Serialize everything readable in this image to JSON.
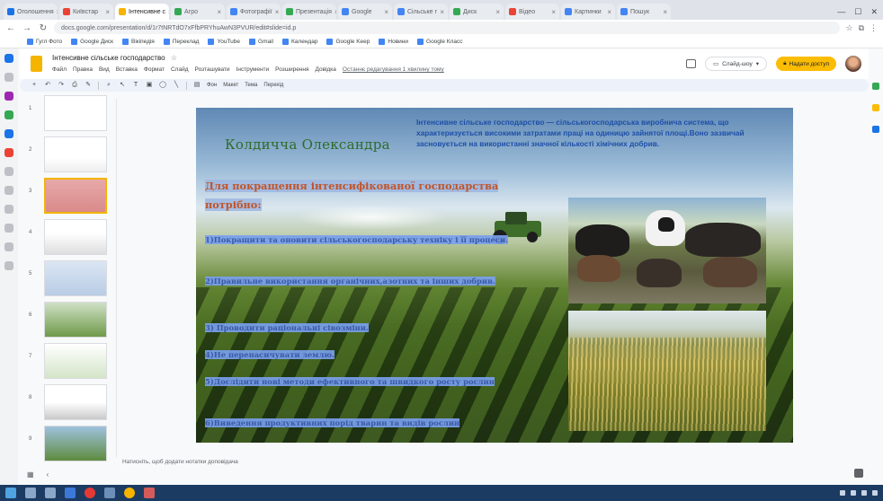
{
  "browser": {
    "tabs": [
      {
        "label": "Оголошення",
        "color": "#1a73e8"
      },
      {
        "label": "Київстар",
        "color": "#ea4335"
      },
      {
        "label": "Інтенсивне с",
        "color": "#f4b400",
        "active": true
      },
      {
        "label": "Агро",
        "color": "#34a853"
      },
      {
        "label": "Фотографії",
        "color": "#4285f4"
      },
      {
        "label": "Презентація",
        "color": "#34a853"
      },
      {
        "label": "Google",
        "color": "#4285f4"
      },
      {
        "label": "Сільське г",
        "color": "#4285f4"
      },
      {
        "label": "Диск",
        "color": "#34a853"
      },
      {
        "label": "Відео",
        "color": "#ea4335"
      },
      {
        "label": "Картинки",
        "color": "#4285f4"
      },
      {
        "label": "Пошук",
        "color": "#4285f4"
      }
    ],
    "url": "docs.google.com/presentation/d/1r7tNRTdO7xFfbPRYhuAwN3PVUR/edit#slide=id.p",
    "bookmarks": [
      "Гугл Фото",
      "Google Диск",
      "Вікіпедія",
      "Переклад",
      "YouTube",
      "Gmail",
      "Календар",
      "Google Keep",
      "Новини",
      "Google Класс"
    ]
  },
  "slides_app": {
    "doc_title": "Інтенсивне сільське господарство",
    "menu": [
      "Файл",
      "Правка",
      "Вид",
      "Вставка",
      "Формат",
      "Слайд",
      "Розташувати",
      "Інструменти",
      "Розширення",
      "Довідка"
    ],
    "last_edit": "Останнє редагування 1 хвилину тому",
    "present_label": "Слайд-шоу",
    "share_label": "Надати доступ",
    "toolbar_background_label": "Фон",
    "toolbar_layout_label": "Макет",
    "toolbar_theme_label": "Тема",
    "toolbar_transition_label": "Перехід"
  },
  "filmstrip": {
    "slide_numbers": [
      "1",
      "2",
      "3",
      "4",
      "5",
      "6",
      "7",
      "8",
      "9"
    ],
    "selected": 3
  },
  "slide": {
    "author": "Колдичча Олександра",
    "definition": "Інтенсивне сільське господарство — сільськогосподарська виробнича система, що характеризується високими затратами праці на одиницю зайнятої площі.Воно зазвичай засновується на використанні значної кількості хімічних добрив.",
    "heading": "Для покращення інтенсифікованої господарства потрібно:",
    "points": [
      "1)Покращити та оновити сільськогосподарську техніку і її процеси.",
      "2)Правильне використання органічних,азотних та інших добрив.",
      "3) Проводити раціональні сівозміни.",
      "4)Не перенасичувати землю.",
      "5)Дослідити нові методи ефективного та швидкого росту рослин",
      "6)Виведення продуктивних порід тварин та видів рослин"
    ]
  },
  "speaker_notes_placeholder": "Натисніть, щоб додати нотатки доповідача",
  "colors": {
    "author": "#2e6b2a",
    "definition": "#1d4fa8",
    "heading": "#c0552a",
    "points": "#3b59a8",
    "highlight": "#78a0ec",
    "share": "#fbbc04"
  }
}
